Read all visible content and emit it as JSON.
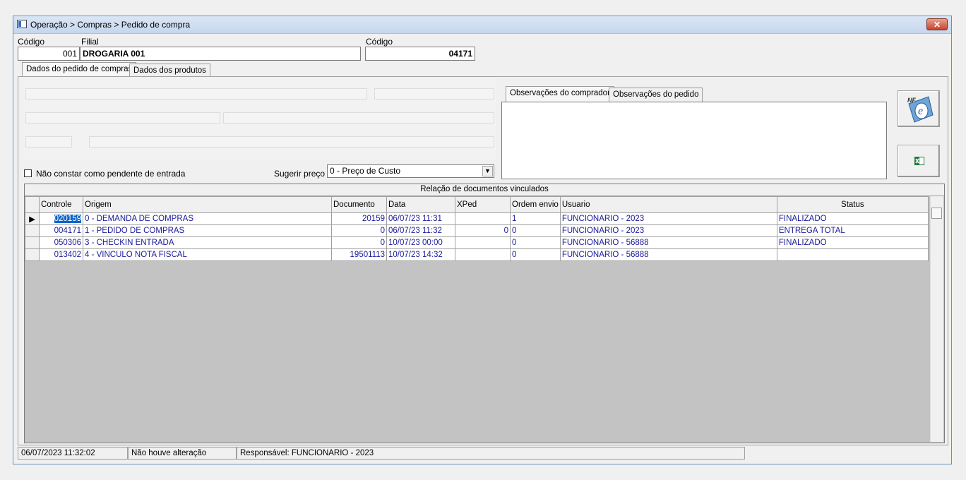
{
  "window": {
    "title": "Operação > Compras > Pedido de compra",
    "close_label": "✕"
  },
  "header": {
    "codigo_label": "Código",
    "codigo_value": "001",
    "filial_label": "Filial",
    "filial_value": "DROGARIA 001",
    "codigo2_label": "Código",
    "codigo2_value": "04171"
  },
  "tabs": [
    {
      "label": "Dados do pedido de compras",
      "active": true
    },
    {
      "label": "Dados dos produtos",
      "active": false
    }
  ],
  "obs_tabs": [
    {
      "label": "Observações do comprador",
      "active": true
    },
    {
      "label": "Observações do pedido",
      "active": false
    }
  ],
  "options": {
    "checkbox_label": "Não constar como pendente de entrada",
    "checkbox_checked": false,
    "sugerir_label": "Sugerir preço :",
    "sugerir_value": "0 - Preço de Custo"
  },
  "icons": {
    "nfe": "nfe-icon",
    "excel": "excel-icon"
  },
  "grid": {
    "title": "Relação de documentos vinculados",
    "columns": [
      "Controle",
      "Origem",
      "Documento",
      "Data",
      "XPed",
      "Ordem envio",
      "Usuario",
      "Status"
    ],
    "rows": [
      {
        "controle": "020159",
        "origem": "0 - DEMANDA DE COMPRAS",
        "documento": "20159",
        "data": "06/07/23 11:31",
        "xped": "",
        "ordem": "1",
        "usuario": "FUNCIONARIO - 2023",
        "status": "FINALIZADO",
        "current": true
      },
      {
        "controle": "004171",
        "origem": "1 - PEDIDO DE COMPRAS",
        "documento": "0",
        "data": "06/07/23 11:32",
        "xped": "0",
        "ordem": "0",
        "usuario": "FUNCIONARIO - 2023",
        "status": "ENTREGA TOTAL",
        "current": false
      },
      {
        "controle": "050306",
        "origem": "3 - CHECKIN ENTRADA",
        "documento": "0",
        "data": "10/07/23 00:00",
        "xped": "",
        "ordem": "0",
        "usuario": "FUNCIONARIO - 56888",
        "status": "FINALIZADO",
        "current": false
      },
      {
        "controle": "013402",
        "origem": "4 - VINCULO NOTA FISCAL",
        "documento": "19501113",
        "data": "10/07/23 14:32",
        "xped": "",
        "ordem": "0",
        "usuario": "FUNCIONARIO - 56888",
        "status": "",
        "current": false
      }
    ]
  },
  "statusbar": {
    "datetime": "06/07/2023 11:32:02",
    "change": "Não houve alteração",
    "responsavel": "Responsável: FUNCIONARIO - 2023"
  }
}
